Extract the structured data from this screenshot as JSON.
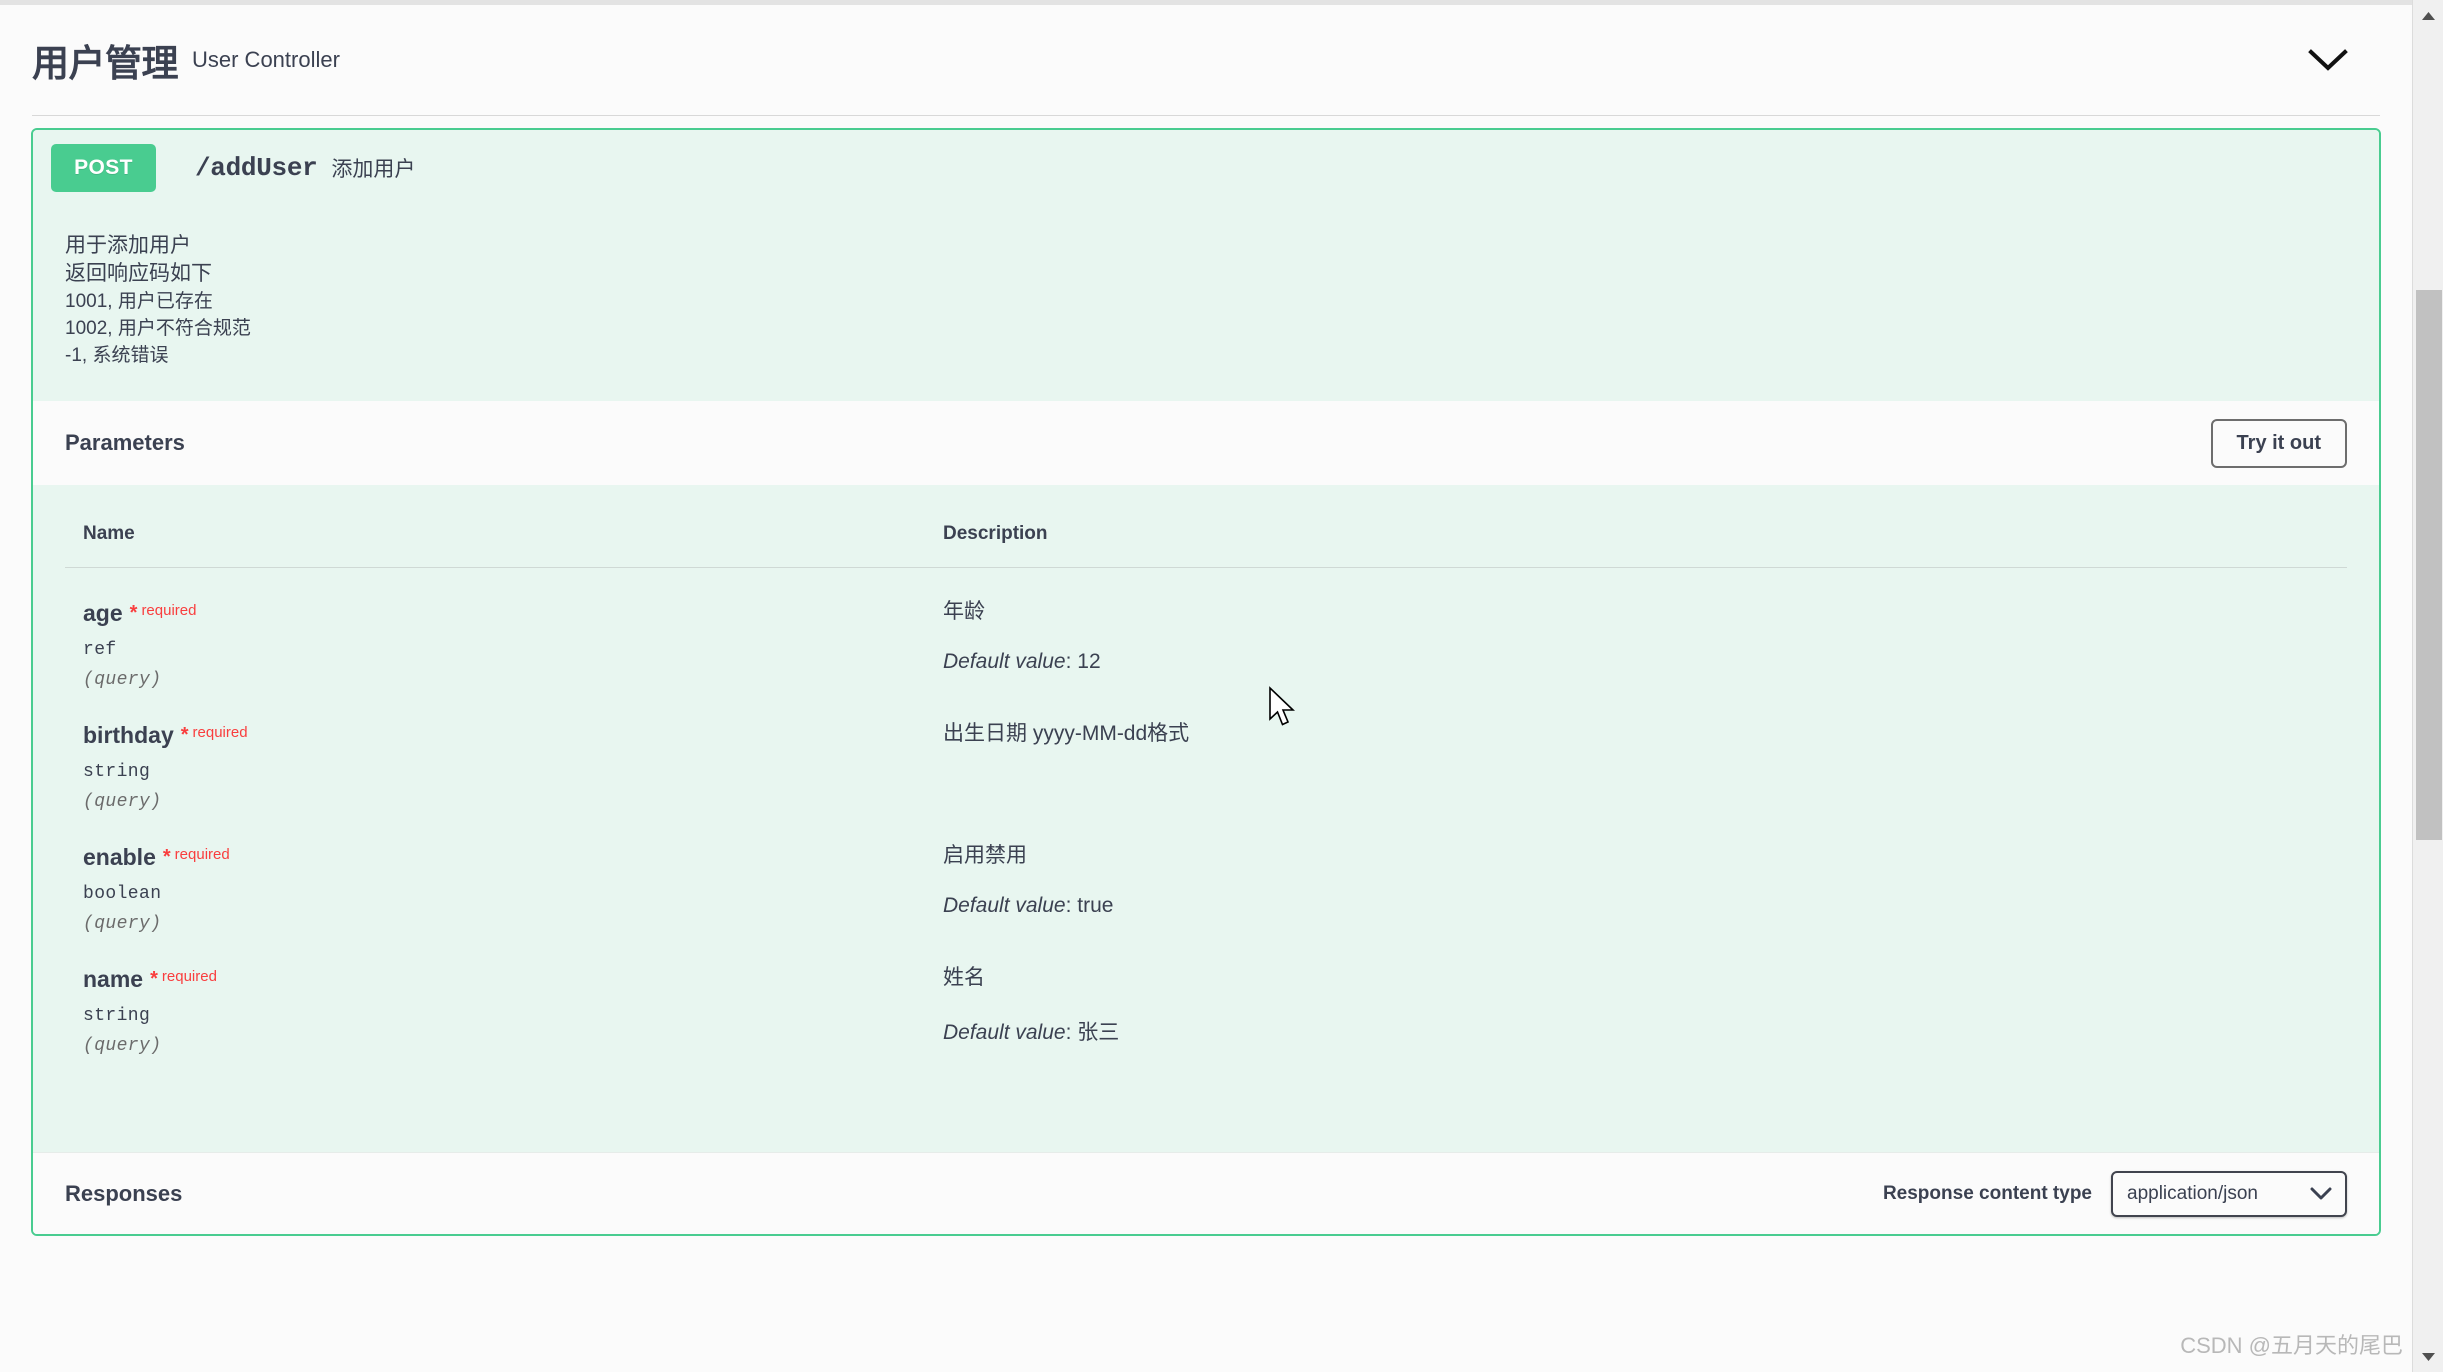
{
  "tag": {
    "title": "用户管理",
    "subtitle": "User Controller",
    "collapse_icon": "chevron-down-icon"
  },
  "operation": {
    "method": "POST",
    "path": "/addUser",
    "summary": "添加用户",
    "description_lines": [
      "用于添加用户",
      "返回响应码如下",
      "1001, 用户已存在",
      "1002, 用户不符合规范",
      "-1, 系统错误"
    ]
  },
  "parameters_section": {
    "title": "Parameters",
    "try_it_out_label": "Try it out",
    "columns": {
      "name": "Name",
      "description": "Description"
    },
    "rows": [
      {
        "name": "age",
        "required_star": "*",
        "required_text": "required",
        "type": "ref",
        "in": "(query)",
        "description": "年龄",
        "default_label": "Default value",
        "default_sep": ":",
        "default_value": "12"
      },
      {
        "name": "birthday",
        "required_star": "*",
        "required_text": "required",
        "type": "string",
        "in": "(query)",
        "description": "出生日期 yyyy-MM-dd格式",
        "default_label": "",
        "default_sep": "",
        "default_value": ""
      },
      {
        "name": "enable",
        "required_star": "*",
        "required_text": "required",
        "type": "boolean",
        "in": "(query)",
        "description": "启用禁用",
        "default_label": "Default value",
        "default_sep": ":",
        "default_value": "true"
      },
      {
        "name": "name",
        "required_star": "*",
        "required_text": "required",
        "type": "string",
        "in": "(query)",
        "description": "姓名",
        "default_label": "Default value",
        "default_sep": ":",
        "default_value": "张三"
      }
    ]
  },
  "responses_section": {
    "title": "Responses",
    "content_type_label": "Response content type",
    "content_type_value": "application/json",
    "caret_icon": "chevron-down-icon"
  },
  "scrollbar": {
    "up_icon": "scroll-up-arrow-icon",
    "down_icon": "scroll-down-arrow-icon"
  },
  "watermark": "CSDN @五月天的尾巴",
  "colors": {
    "method_green": "#49cc90",
    "block_bg": "#e8f6f0",
    "required_red": "#f93e3e",
    "text": "#3b4151",
    "page_bg": "#fbfbfb"
  }
}
